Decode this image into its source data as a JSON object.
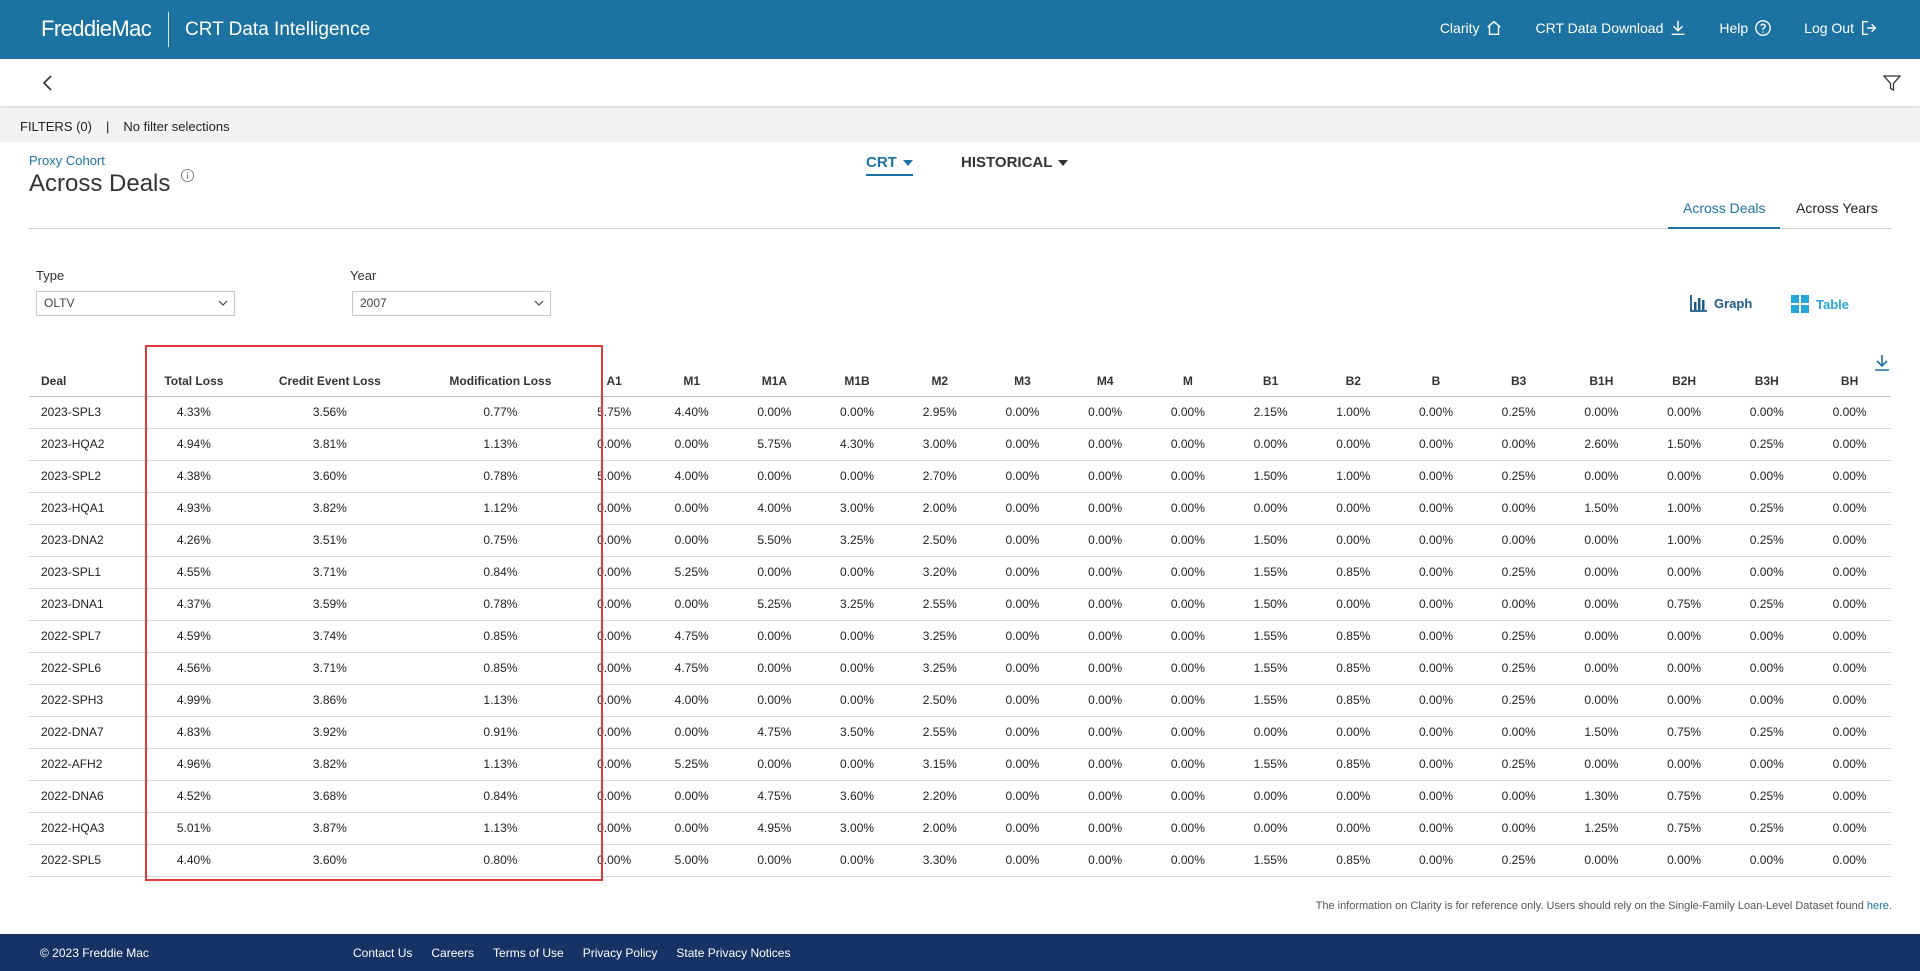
{
  "header": {
    "brand": "FreddieMac",
    "app_title": "CRT Data Intelligence",
    "nav": [
      {
        "label": "Clarity",
        "icon": "home-icon"
      },
      {
        "label": "CRT Data Download",
        "icon": "download-icon"
      },
      {
        "label": "Help",
        "icon": "help-icon"
      },
      {
        "label": "Log Out",
        "icon": "logout-icon"
      }
    ]
  },
  "filters": {
    "label": "FILTERS (0)",
    "separator": "|",
    "status": "No filter selections"
  },
  "title": {
    "cohort_link": "Proxy Cohort",
    "heading": "Across Deals"
  },
  "dropdowns": {
    "crt": "CRT",
    "historical": "HISTORICAL"
  },
  "tabs": {
    "active": "Across Deals",
    "inactive": "Across Years"
  },
  "selects": {
    "type": {
      "label": "Type",
      "value": "OLTV"
    },
    "year": {
      "label": "Year",
      "value": "2007"
    }
  },
  "views": {
    "graph": "Graph",
    "table": "Table"
  },
  "table": {
    "columns": [
      "Deal",
      "Total Loss",
      "Credit Event Loss",
      "Modification Loss",
      "A1",
      "M1",
      "M1A",
      "M1B",
      "M2",
      "M3",
      "M4",
      "M",
      "B1",
      "B2",
      "B",
      "B3",
      "B1H",
      "B2H",
      "B3H",
      "BH"
    ],
    "rows": [
      [
        "2023-SPL3",
        "4.33%",
        "3.56%",
        "0.77%",
        "5.75%",
        "4.40%",
        "0.00%",
        "0.00%",
        "2.95%",
        "0.00%",
        "0.00%",
        "0.00%",
        "2.15%",
        "1.00%",
        "0.00%",
        "0.25%",
        "0.00%",
        "0.00%",
        "0.00%",
        "0.00%"
      ],
      [
        "2023-HQA2",
        "4.94%",
        "3.81%",
        "1.13%",
        "0.00%",
        "0.00%",
        "5.75%",
        "4.30%",
        "3.00%",
        "0.00%",
        "0.00%",
        "0.00%",
        "0.00%",
        "0.00%",
        "0.00%",
        "0.00%",
        "2.60%",
        "1.50%",
        "0.25%",
        "0.00%"
      ],
      [
        "2023-SPL2",
        "4.38%",
        "3.60%",
        "0.78%",
        "5.00%",
        "4.00%",
        "0.00%",
        "0.00%",
        "2.70%",
        "0.00%",
        "0.00%",
        "0.00%",
        "1.50%",
        "1.00%",
        "0.00%",
        "0.25%",
        "0.00%",
        "0.00%",
        "0.00%",
        "0.00%"
      ],
      [
        "2023-HQA1",
        "4.93%",
        "3.82%",
        "1.12%",
        "0.00%",
        "0.00%",
        "4.00%",
        "3.00%",
        "2.00%",
        "0.00%",
        "0.00%",
        "0.00%",
        "0.00%",
        "0.00%",
        "0.00%",
        "0.00%",
        "1.50%",
        "1.00%",
        "0.25%",
        "0.00%"
      ],
      [
        "2023-DNA2",
        "4.26%",
        "3.51%",
        "0.75%",
        "0.00%",
        "0.00%",
        "5.50%",
        "3.25%",
        "2.50%",
        "0.00%",
        "0.00%",
        "0.00%",
        "1.50%",
        "0.00%",
        "0.00%",
        "0.00%",
        "0.00%",
        "1.00%",
        "0.25%",
        "0.00%"
      ],
      [
        "2023-SPL1",
        "4.55%",
        "3.71%",
        "0.84%",
        "0.00%",
        "5.25%",
        "0.00%",
        "0.00%",
        "3.20%",
        "0.00%",
        "0.00%",
        "0.00%",
        "1.55%",
        "0.85%",
        "0.00%",
        "0.25%",
        "0.00%",
        "0.00%",
        "0.00%",
        "0.00%"
      ],
      [
        "2023-DNA1",
        "4.37%",
        "3.59%",
        "0.78%",
        "0.00%",
        "0.00%",
        "5.25%",
        "3.25%",
        "2.55%",
        "0.00%",
        "0.00%",
        "0.00%",
        "1.50%",
        "0.00%",
        "0.00%",
        "0.00%",
        "0.00%",
        "0.75%",
        "0.25%",
        "0.00%"
      ],
      [
        "2022-SPL7",
        "4.59%",
        "3.74%",
        "0.85%",
        "0.00%",
        "4.75%",
        "0.00%",
        "0.00%",
        "3.25%",
        "0.00%",
        "0.00%",
        "0.00%",
        "1.55%",
        "0.85%",
        "0.00%",
        "0.25%",
        "0.00%",
        "0.00%",
        "0.00%",
        "0.00%"
      ],
      [
        "2022-SPL6",
        "4.56%",
        "3.71%",
        "0.85%",
        "0.00%",
        "4.75%",
        "0.00%",
        "0.00%",
        "3.25%",
        "0.00%",
        "0.00%",
        "0.00%",
        "1.55%",
        "0.85%",
        "0.00%",
        "0.25%",
        "0.00%",
        "0.00%",
        "0.00%",
        "0.00%"
      ],
      [
        "2022-SPH3",
        "4.99%",
        "3.86%",
        "1.13%",
        "0.00%",
        "4.00%",
        "0.00%",
        "0.00%",
        "2.50%",
        "0.00%",
        "0.00%",
        "0.00%",
        "1.55%",
        "0.85%",
        "0.00%",
        "0.25%",
        "0.00%",
        "0.00%",
        "0.00%",
        "0.00%"
      ],
      [
        "2022-DNA7",
        "4.83%",
        "3.92%",
        "0.91%",
        "0.00%",
        "0.00%",
        "4.75%",
        "3.50%",
        "2.55%",
        "0.00%",
        "0.00%",
        "0.00%",
        "0.00%",
        "0.00%",
        "0.00%",
        "0.00%",
        "1.50%",
        "0.75%",
        "0.25%",
        "0.00%"
      ],
      [
        "2022-AFH2",
        "4.96%",
        "3.82%",
        "1.13%",
        "0.00%",
        "5.25%",
        "0.00%",
        "0.00%",
        "3.15%",
        "0.00%",
        "0.00%",
        "0.00%",
        "1.55%",
        "0.85%",
        "0.00%",
        "0.25%",
        "0.00%",
        "0.00%",
        "0.00%",
        "0.00%"
      ],
      [
        "2022-DNA6",
        "4.52%",
        "3.68%",
        "0.84%",
        "0.00%",
        "0.00%",
        "4.75%",
        "3.60%",
        "2.20%",
        "0.00%",
        "0.00%",
        "0.00%",
        "0.00%",
        "0.00%",
        "0.00%",
        "0.00%",
        "1.30%",
        "0.75%",
        "0.25%",
        "0.00%"
      ],
      [
        "2022-HQA3",
        "5.01%",
        "3.87%",
        "1.13%",
        "0.00%",
        "0.00%",
        "4.95%",
        "3.00%",
        "2.00%",
        "0.00%",
        "0.00%",
        "0.00%",
        "0.00%",
        "0.00%",
        "0.00%",
        "0.00%",
        "1.25%",
        "0.75%",
        "0.25%",
        "0.00%"
      ],
      [
        "2022-SPL5",
        "4.40%",
        "3.60%",
        "0.80%",
        "0.00%",
        "5.00%",
        "0.00%",
        "0.00%",
        "3.30%",
        "0.00%",
        "0.00%",
        "0.00%",
        "1.55%",
        "0.85%",
        "0.00%",
        "0.25%",
        "0.00%",
        "0.00%",
        "0.00%",
        "0.00%"
      ]
    ]
  },
  "note": {
    "text": "The information on Clarity is for reference only. Users should rely on the Single-Family Loan-Level Dataset found ",
    "link": "here",
    "suffix": "."
  },
  "footer": {
    "copyright": "© 2023 Freddie Mac",
    "links": [
      "Contact Us",
      "Careers",
      "Terms of Use",
      "Privacy Policy",
      "State Privacy Notices"
    ]
  },
  "colors": {
    "brand_blue": "#1c73a1",
    "footer_navy": "#173366",
    "highlight_red": "#e03a3a"
  }
}
